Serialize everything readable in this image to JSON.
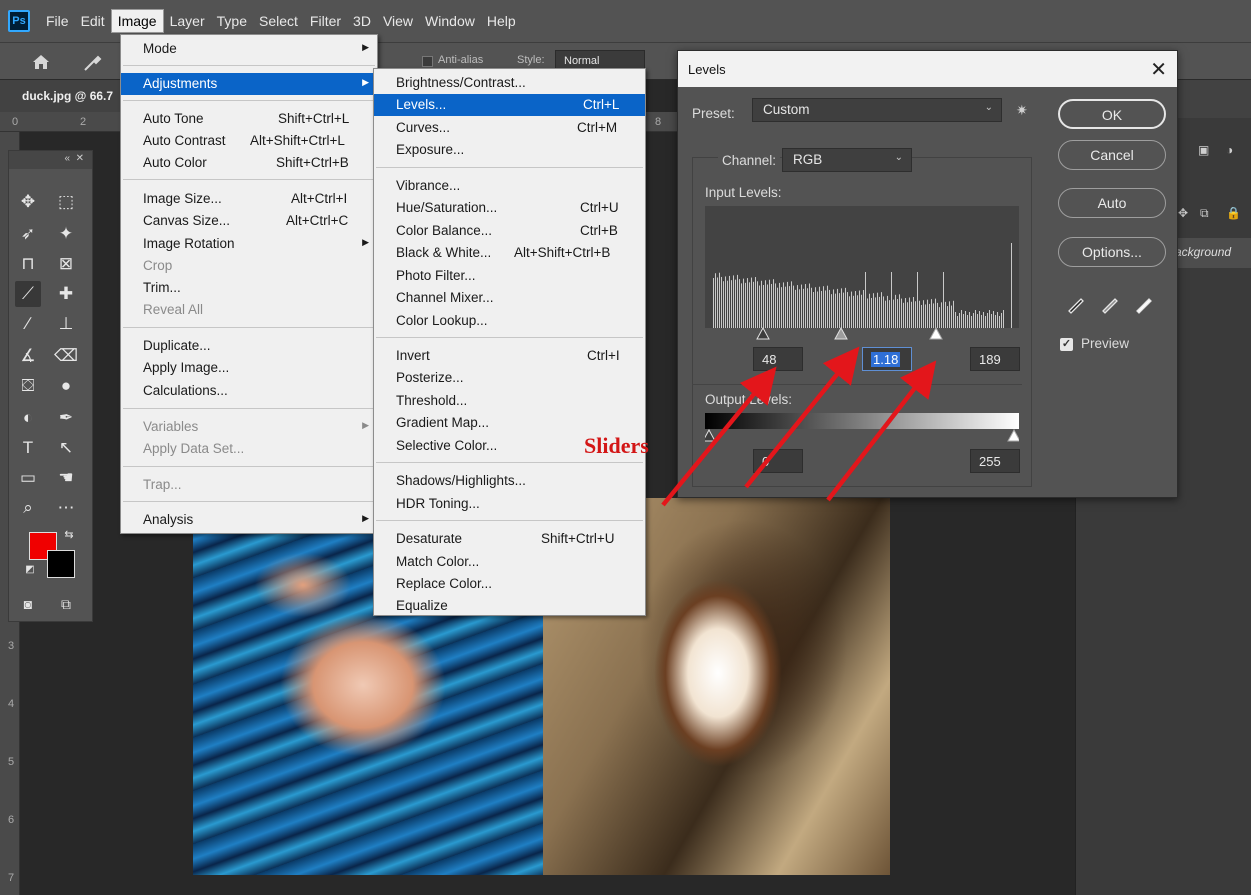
{
  "menubar": {
    "logo": "Ps",
    "items": [
      "File",
      "Edit",
      "Image",
      "Layer",
      "Type",
      "Select",
      "Filter",
      "3D",
      "View",
      "Window",
      "Help"
    ]
  },
  "options_bar": {
    "anti_alias_label": "Anti-alias",
    "style_label": "Style:",
    "style_value": "Normal"
  },
  "document": {
    "tab_title": "duck.jpg @ 66.7",
    "ruler_top_numbers": [
      "0",
      "2",
      "8"
    ],
    "ruler_left_numbers": [
      "3",
      "4",
      "5",
      "6",
      "7"
    ]
  },
  "image_menu": {
    "items": [
      {
        "label": "Mode",
        "submenu": true
      },
      {
        "label": "Adjustments",
        "submenu": true,
        "highlighted": true
      },
      {
        "label": "Auto Tone",
        "shortcut": "Shift+Ctrl+L"
      },
      {
        "label": "Auto Contrast",
        "shortcut": "Alt+Shift+Ctrl+L"
      },
      {
        "label": "Auto Color",
        "shortcut": "Shift+Ctrl+B"
      },
      {
        "label": "Image Size...",
        "shortcut": "Alt+Ctrl+I"
      },
      {
        "label": "Canvas Size...",
        "shortcut": "Alt+Ctrl+C"
      },
      {
        "label": "Image Rotation",
        "submenu": true
      },
      {
        "label": "Crop",
        "disabled": true
      },
      {
        "label": "Trim..."
      },
      {
        "label": "Reveal All",
        "disabled": true
      },
      {
        "label": "Duplicate..."
      },
      {
        "label": "Apply Image..."
      },
      {
        "label": "Calculations..."
      },
      {
        "label": "Variables",
        "submenu": true,
        "disabled": true
      },
      {
        "label": "Apply Data Set...",
        "disabled": true
      },
      {
        "label": "Trap...",
        "disabled": true
      },
      {
        "label": "Analysis",
        "submenu": true
      }
    ]
  },
  "adjustments_menu": {
    "items": [
      {
        "label": "Brightness/Contrast..."
      },
      {
        "label": "Levels...",
        "shortcut": "Ctrl+L",
        "highlighted": true
      },
      {
        "label": "Curves...",
        "shortcut": "Ctrl+M"
      },
      {
        "label": "Exposure..."
      },
      {
        "label": "Vibrance..."
      },
      {
        "label": "Hue/Saturation...",
        "shortcut": "Ctrl+U"
      },
      {
        "label": "Color Balance...",
        "shortcut": "Ctrl+B"
      },
      {
        "label": "Black & White...",
        "shortcut": "Alt+Shift+Ctrl+B"
      },
      {
        "label": "Photo Filter..."
      },
      {
        "label": "Channel Mixer..."
      },
      {
        "label": "Color Lookup..."
      },
      {
        "label": "Invert",
        "shortcut": "Ctrl+I"
      },
      {
        "label": "Posterize..."
      },
      {
        "label": "Threshold..."
      },
      {
        "label": "Gradient Map..."
      },
      {
        "label": "Selective Color..."
      },
      {
        "label": "Shadows/Highlights..."
      },
      {
        "label": "HDR Toning..."
      },
      {
        "label": "Desaturate",
        "shortcut": "Shift+Ctrl+U"
      },
      {
        "label": "Match Color..."
      },
      {
        "label": "Replace Color..."
      },
      {
        "label": "Equalize"
      }
    ]
  },
  "levels_dialog": {
    "title": "Levels",
    "preset_label": "Preset:",
    "preset_value": "Custom",
    "channel_label": "Channel:",
    "channel_value": "RGB",
    "input_levels_label": "Input Levels:",
    "input_black": "48",
    "input_gamma": "1.18",
    "input_white": "189",
    "output_levels_label": "Output Levels:",
    "output_black": "0",
    "output_white": "255",
    "buttons": {
      "ok": "OK",
      "cancel": "Cancel",
      "auto": "Auto",
      "options": "Options..."
    },
    "preview_label": "Preview",
    "preview_checked": true
  },
  "layers_panel": {
    "layer_name": "Background"
  },
  "annotation": {
    "label": "Sliders",
    "color": "#d31616"
  },
  "colors": {
    "foreground": "#f00000",
    "background": "#000000",
    "menu_highlight": "#0a64c8"
  }
}
